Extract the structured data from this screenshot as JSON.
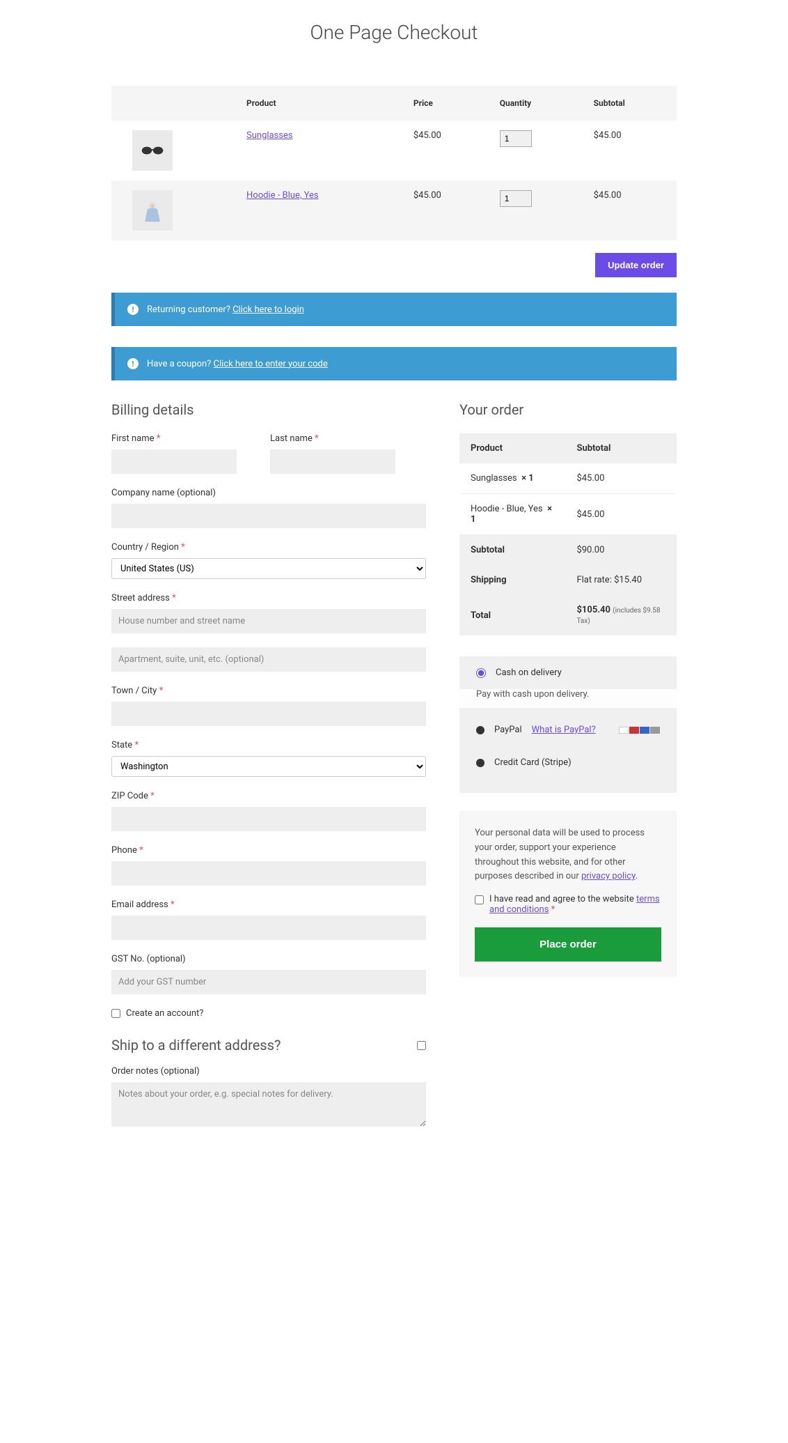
{
  "page_title": "One Page Checkout",
  "cart": {
    "headers": {
      "product": "Product",
      "price": "Price",
      "quantity": "Quantity",
      "subtotal": "Subtotal"
    },
    "items": [
      {
        "name": "Sunglasses",
        "price": "$45.00",
        "qty": "1",
        "subtotal": "$45.00"
      },
      {
        "name": "Hoodie - Blue, Yes",
        "price": "$45.00",
        "qty": "1",
        "subtotal": "$45.00"
      }
    ],
    "update_label": "Update order"
  },
  "notices": {
    "returning_prefix": "Returning customer? ",
    "returning_link": "Click here to login",
    "coupon_prefix": "Have a coupon? ",
    "coupon_link": "Click here to enter your code"
  },
  "billing": {
    "heading": "Billing details",
    "first_name": "First name",
    "last_name": "Last name",
    "company": "Company name (optional)",
    "country": "Country / Region",
    "country_value": "United States (US)",
    "street": "Street address",
    "street_ph": "House number and street name",
    "street2_ph": "Apartment, suite, unit, etc. (optional)",
    "city": "Town / City",
    "state": "State",
    "state_value": "Washington",
    "zip": "ZIP Code",
    "phone": "Phone",
    "email": "Email address",
    "gst": "GST No. (optional)",
    "gst_ph": "Add your GST number",
    "create_account": "Create an account?"
  },
  "ship": {
    "heading": "Ship to a different address?",
    "notes_label": "Order notes (optional)",
    "notes_ph": "Notes about your order, e.g. special notes for delivery."
  },
  "order": {
    "heading": "Your order",
    "col_product": "Product",
    "col_subtotal": "Subtotal",
    "lines": [
      {
        "name": "Sunglasses",
        "qty": "× 1",
        "subtotal": "$45.00"
      },
      {
        "name": "Hoodie - Blue, Yes",
        "qty": "× 1",
        "subtotal": "$45.00"
      }
    ],
    "subtotal_label": "Subtotal",
    "subtotal_value": "$90.00",
    "shipping_label": "Shipping",
    "shipping_value": "Flat rate: $15.40",
    "total_label": "Total",
    "total_value": "$105.40",
    "tax_note": "(includes $9.58 Tax)"
  },
  "payment": {
    "cod": "Cash on delivery",
    "cod_desc": "Pay with cash upon delivery.",
    "paypal": "PayPal",
    "paypal_help": "What is PayPal?",
    "stripe": "Credit Card (Stripe)"
  },
  "privacy": {
    "text_prefix": "Your personal data will be used to process your order, support your experience throughout this website, and for other purposes described in our ",
    "policy_link": "privacy policy",
    "terms_prefix": "I have read and agree to the website ",
    "terms_link": "terms and conditions",
    "place_order": "Place order"
  }
}
